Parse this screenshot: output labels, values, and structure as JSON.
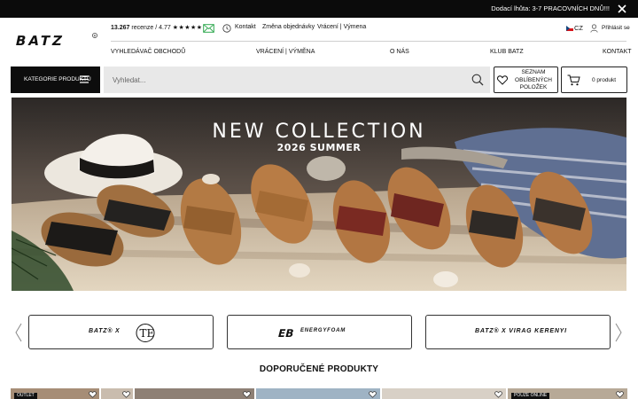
{
  "topbar": {
    "notice": "Dodací lhůta: 3-7 PRACOVNÍCH DNŮ!!!",
    "close_icon": "close-icon"
  },
  "header": {
    "logo_text": "BATZ",
    "reviews_count": "13.267",
    "reviews_rest": " recenze / 4.77 ",
    "reviews_stars": "★★★★★",
    "contact": "Kontakt",
    "order_change": "Změna objednávky",
    "returns": "Vrácení | Výmena",
    "language": "CZ",
    "login": "Přihlásit se",
    "icons": [
      "mail-icon",
      "info-icon",
      "flag-icon",
      "user-icon"
    ]
  },
  "nav": {
    "items": [
      "VYHLEDÁVAČ OBCHODŮ",
      "VRÁCENÍ | VÝMĚNA",
      "O NÁS",
      "KLUB BATZ",
      "KONTAKT"
    ]
  },
  "search_row": {
    "categories_label": "KATEGORIE PRODUKTŮ",
    "search_placeholder": "Vyhledat...",
    "favorites_label": "SEZNAM OBLÍBENÝCH POLOŽEK",
    "cart_label": "0 produkt",
    "icons": [
      "menu-icon",
      "search-icon",
      "heart-icon",
      "cart-icon"
    ]
  },
  "hero": {
    "title": "NEW COLLECTION",
    "subtitle": "2026 SUMMER"
  },
  "brands": [
    {
      "label": "BATZ® X ",
      "icon": "te-monogram-icon"
    },
    {
      "label": "ENERGYFOAM",
      "icon": "eb-logo-icon"
    },
    {
      "label": "BATZ® X VIRAG KERENYI",
      "icon": ""
    }
  ],
  "section": {
    "title": "DOPORUČENÉ PRODUKTY"
  },
  "products": [
    {
      "badge": "OUTLET"
    },
    {
      "badge": ""
    },
    {
      "badge": ""
    },
    {
      "badge": ""
    },
    {
      "badge": ""
    },
    {
      "badge": "POUZE ONLINE"
    }
  ],
  "colors": {
    "topbar": "#0b0b0b",
    "search_bg": "#e8e8e8",
    "text": "#111111"
  }
}
